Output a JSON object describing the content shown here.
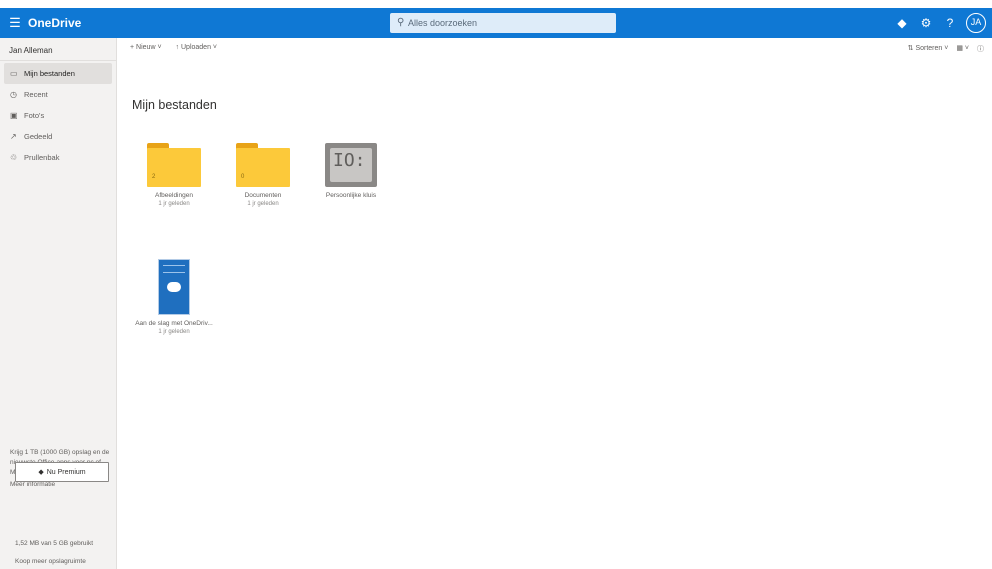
{
  "topbar": {
    "app_name": "OneDrive",
    "search_placeholder": "Alles doorzoeken",
    "icons": [
      "premium-diamond-icon",
      "settings-gear-icon",
      "help-icon",
      "account-avatar-icon"
    ]
  },
  "sidebar": {
    "user_name": "Jan Alleman",
    "items": [
      {
        "label": "Mijn bestanden",
        "icon": "files-icon",
        "active": true
      },
      {
        "label": "Recent",
        "icon": "clock-icon",
        "active": false
      },
      {
        "label": "Foto's",
        "icon": "photos-icon",
        "active": false
      },
      {
        "label": "Gedeeld",
        "icon": "share-icon",
        "active": false
      },
      {
        "label": "Prullenbak",
        "icon": "trash-icon",
        "active": false
      }
    ],
    "promo_text": "Krijg 1 TB (1000 GB) opslag en de nieuwste Office-apps voor pc of Mac",
    "promo_link": "Meer informatie",
    "promo_button": "Nu Premium",
    "storage_used": "1,52 MB van 5 GB gebruikt",
    "storage_link": "Koop meer opslagruimte"
  },
  "commandbar": {
    "new_label": "Nieuw",
    "upload_label": "Uploaden",
    "sort_label": "Sorteren",
    "view_icon": "view-grid-icon",
    "details_icon": "info-icon"
  },
  "main": {
    "title": "Mijn bestanden",
    "items": [
      {
        "name": "Afbeeldingen",
        "sub": "1 jr geleden",
        "type": "folder",
        "count": "2"
      },
      {
        "name": "Documenten",
        "sub": "1 jr geleden",
        "type": "folder",
        "count": "0"
      },
      {
        "name": "Persoonlijke kluis",
        "sub": "",
        "type": "vault"
      },
      {
        "name": "Aan de slag met OneDriv...",
        "sub": "1 jr geleden",
        "type": "document"
      }
    ]
  },
  "colors": {
    "accent": "#0f78d4",
    "folder": "#fcc93a",
    "sidebar_bg": "#f3f2f1"
  }
}
